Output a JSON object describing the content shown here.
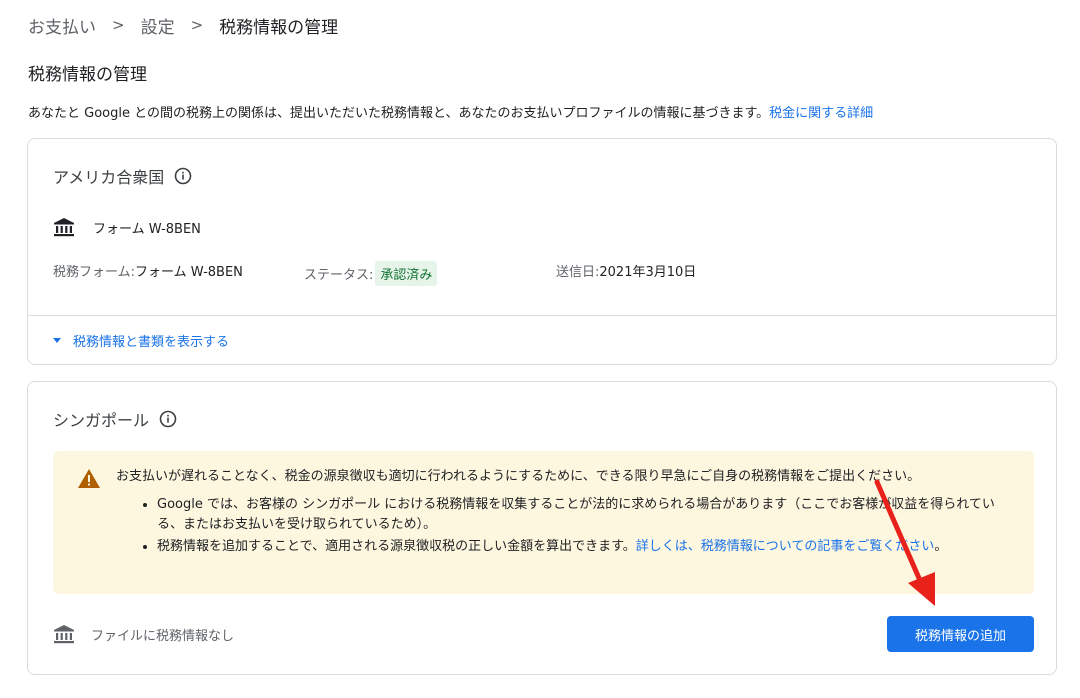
{
  "breadcrumb": [
    "お支払い",
    "設定",
    "税務情報の管理"
  ],
  "page_title": "税務情報の管理",
  "intro": {
    "text": "あなたと Google との間の税務上の関係は、提出いただいた税務情報と、あなたのお支払いプロファイルの情報に基づきます。",
    "link": "税金に関する詳細"
  },
  "us_card": {
    "title": "アメリカ合衆国",
    "form_name": "フォーム W-8BEN",
    "tax_form_label": "税務フォーム: ",
    "tax_form_value": "フォーム W-8BEN",
    "status_label": "ステータス: ",
    "status_value": "承認済み",
    "sent_label": "送信日: ",
    "sent_value": "2021年3月10日",
    "expand_label": "税務情報と書類を表示する"
  },
  "sg_card": {
    "title": "シンガポール",
    "warning": {
      "text": "お支払いが遅れることなく、税金の源泉徴収も適切に行われるようにするために、できる限り早急にご自身の税務情報をご提出ください。",
      "bullet1": "Google では、お客様の シンガポール における税務情報を収集することが法的に求められる場合があります（ここでお客様が収益を得られている、またはお支払いを受け取られているため）。",
      "bullet2_text": "税務情報を追加することで、適用される源泉徴収税の正しい金額を算出できます。",
      "bullet2_link": "詳しくは、税務情報についての記事をご覧ください",
      "bullet2_end": "。"
    },
    "no_file": "ファイルに税務情報なし",
    "add_button": "税務情報の追加"
  },
  "icons": {
    "info": "info-icon",
    "bank": "bank-icon",
    "warning": "warning-icon",
    "arrow": "red-arrow"
  },
  "colors": {
    "link": "#1a73e8",
    "badge_bg": "#e6f4ea",
    "badge_text": "#137333",
    "warning_bg": "#fef7e0",
    "warning_icon": "#b06000",
    "button": "#1a73e8",
    "arrow": "#e8211b"
  }
}
